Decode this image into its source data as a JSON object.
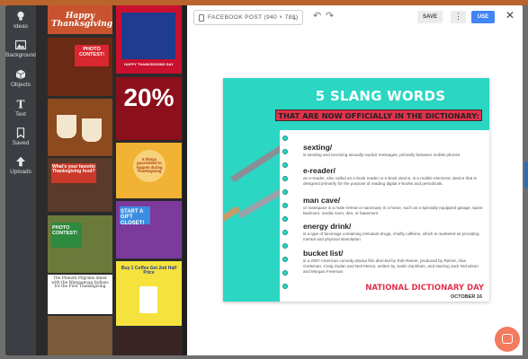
{
  "sidebar": {
    "items": [
      {
        "label": "Ideas",
        "icon": "lightbulb-icon"
      },
      {
        "label": "Backgrounds",
        "icon": "image-icon"
      },
      {
        "label": "Objects",
        "icon": "cube-icon"
      },
      {
        "label": "Text",
        "icon": "text-icon"
      },
      {
        "label": "Saved",
        "icon": "bookmark-icon"
      },
      {
        "label": "Uploads",
        "icon": "upload-arrow-icon"
      }
    ]
  },
  "templates": {
    "items": [
      {
        "text": "Happy Thanksgiving"
      },
      {
        "text": "HAPPY THANKSGIVING DAY"
      },
      {
        "text": "PHOTO CONTEST!"
      },
      {
        "text": "20%"
      },
      {
        "text": ""
      },
      {
        "text": "5 things guaranteed to happen during Thanksgiving"
      },
      {
        "text": "What's your favorite Thanksgiving food?"
      },
      {
        "text": "START A GIFT CLOSET!"
      },
      {
        "text": "PHOTO CONTEST!"
      },
      {
        "text": "Buy 1 Coffee Get 2nd Half Price"
      },
      {
        "text": "The Plimoth Pilgrims dined with the Wampanoag Indians for the First Thanksgiving"
      },
      {
        "text": ""
      }
    ]
  },
  "toolbar": {
    "size_label": "FACEBOOK POST (940 × 788)",
    "save_label": "SAVE",
    "more_label": "⋮",
    "use_label": "USE",
    "close_label": "✕",
    "undo_label": "↶",
    "redo_label": "↷"
  },
  "design": {
    "title": "5 SLANG WORDS",
    "subtitle": "THAT ARE NOW OFFICIALLY IN THE DICTIONARY:",
    "entries": [
      {
        "word": "sexting/",
        "definition": "is sending and receiving sexually explicit messages, primarily between mobile phones"
      },
      {
        "word": "e-reader/",
        "definition": "an e-reader, also called an e-book reader or e-book device, is a mobile electronic device that is designed primarily for the purpose of reading digital e-books and periodicals."
      },
      {
        "word": "man cave/",
        "definition": "or manspace is a male retreat or sanctuary in a home, such as a specially equipped garage, spare bedroom, media room, den, or basement"
      },
      {
        "word": "energy drink/",
        "definition": "is a type of beverage containing stimulant drugs, chiefly caffeine, which is marketed as providing mental and physical stimulation"
      },
      {
        "word": "bucket list/",
        "definition": "is a 2007 American comedy-drama film directed by Rob Reiner, produced by Reiner, Alan Greisman, Craig Zadan and Neil Meron, written by Justin Zackham, and starring Jack Nicholson and Morgan Freeman"
      }
    ],
    "footer_title": "NATIONAL DICTIONARY DAY",
    "footer_date": "OCTOBER 16"
  },
  "colors": {
    "accent": "#2bd6c3",
    "banner": "#e0324b",
    "use_button": "#4285f4",
    "rail": "#3b3f44",
    "panel": "#2b2b2b",
    "chat": "#f47b5e"
  }
}
